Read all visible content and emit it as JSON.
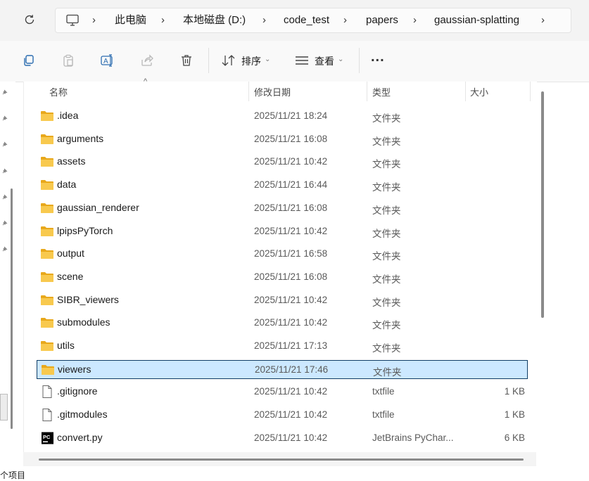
{
  "breadcrumb": {
    "items": [
      "此电脑",
      "本地磁盘 (D:)",
      "code_test",
      "papers",
      "gaussian-splatting"
    ]
  },
  "toolbar": {
    "sort_label": "排序",
    "view_label": "查看",
    "more_label": "..."
  },
  "columns": {
    "name": "名称",
    "date": "修改日期",
    "type": "类型",
    "size": "大小"
  },
  "files": [
    {
      "name": ".idea",
      "date": "2025/11/21 18:24",
      "type": "文件夹",
      "size": "",
      "kind": "folder"
    },
    {
      "name": "arguments",
      "date": "2025/11/21 16:08",
      "type": "文件夹",
      "size": "",
      "kind": "folder"
    },
    {
      "name": "assets",
      "date": "2025/11/21 10:42",
      "type": "文件夹",
      "size": "",
      "kind": "folder"
    },
    {
      "name": "data",
      "date": "2025/11/21 16:44",
      "type": "文件夹",
      "size": "",
      "kind": "folder"
    },
    {
      "name": "gaussian_renderer",
      "date": "2025/11/21 16:08",
      "type": "文件夹",
      "size": "",
      "kind": "folder"
    },
    {
      "name": "lpipsPyTorch",
      "date": "2025/11/21 10:42",
      "type": "文件夹",
      "size": "",
      "kind": "folder"
    },
    {
      "name": "output",
      "date": "2025/11/21 16:58",
      "type": "文件夹",
      "size": "",
      "kind": "folder"
    },
    {
      "name": "scene",
      "date": "2025/11/21 16:08",
      "type": "文件夹",
      "size": "",
      "kind": "folder"
    },
    {
      "name": "SIBR_viewers",
      "date": "2025/11/21 10:42",
      "type": "文件夹",
      "size": "",
      "kind": "folder"
    },
    {
      "name": "submodules",
      "date": "2025/11/21 10:42",
      "type": "文件夹",
      "size": "",
      "kind": "folder"
    },
    {
      "name": "utils",
      "date": "2025/11/21 17:13",
      "type": "文件夹",
      "size": "",
      "kind": "folder"
    },
    {
      "name": "viewers",
      "date": "2025/11/21 17:46",
      "type": "文件夹",
      "size": "",
      "kind": "folder",
      "selected": true
    },
    {
      "name": ".gitignore",
      "date": "2025/11/21 10:42",
      "type": "txtfile",
      "size": "1 KB",
      "kind": "file"
    },
    {
      "name": ".gitmodules",
      "date": "2025/11/21 10:42",
      "type": "txtfile",
      "size": "1 KB",
      "kind": "file"
    },
    {
      "name": "convert.py",
      "date": "2025/11/21 10:42",
      "type": "JetBrains PyChar...",
      "size": "6 KB",
      "kind": "pycharm"
    }
  ],
  "status": {
    "text": "个项目"
  },
  "colors": {
    "folder": "#f8c94e",
    "folder_dark": "#e8a81b",
    "selection_bg": "#cce8ff",
    "selection_border": "#0f3d66"
  }
}
